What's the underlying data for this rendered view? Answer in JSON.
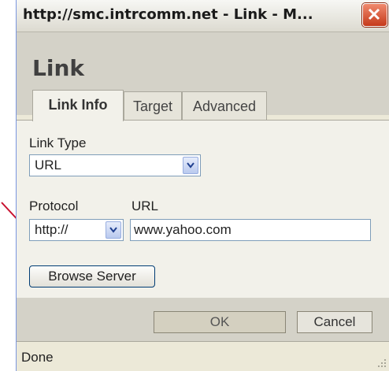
{
  "window": {
    "title": "http://smc.intrcomm.net - Link - M..."
  },
  "dialog": {
    "title": "Link",
    "tabs": [
      {
        "label": "Link Info",
        "active": true
      },
      {
        "label": "Target",
        "active": false
      },
      {
        "label": "Advanced",
        "active": false
      }
    ]
  },
  "form": {
    "link_type_label": "Link Type",
    "link_type_value": "URL",
    "protocol_label": "Protocol",
    "protocol_value": "http://",
    "url_label": "URL",
    "url_value": "www.yahoo.com",
    "browse_label": "Browse Server"
  },
  "buttons": {
    "ok": "OK",
    "cancel": "Cancel"
  },
  "status": {
    "text": "Done"
  },
  "colors": {
    "annotation_arrow": "#c8102e",
    "close_button": "#d9532f"
  },
  "icons": {
    "close": "close-x-icon",
    "dropdown": "chevron-down-icon",
    "resize": "resize-grip-icon"
  }
}
